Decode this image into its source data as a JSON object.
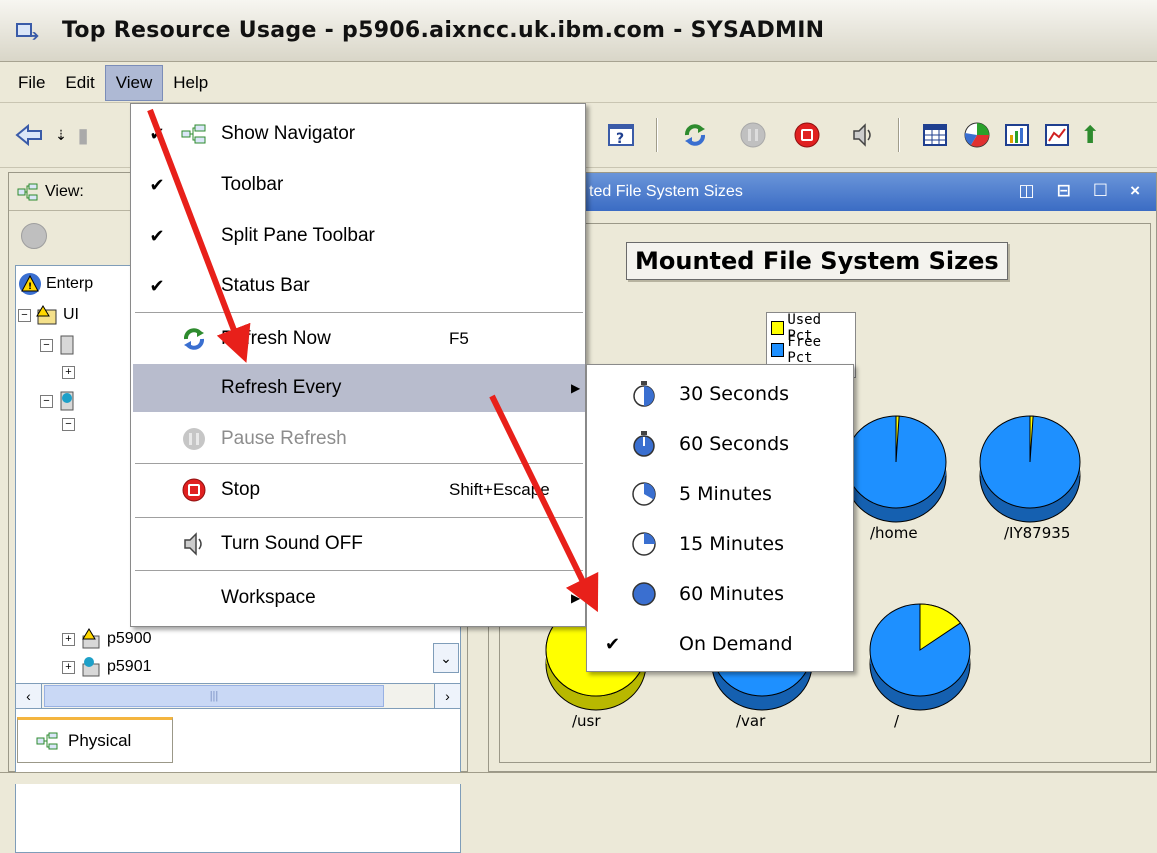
{
  "window": {
    "title": "Top Resource Usage - p5906.aixncc.uk.ibm.com - SYSADMIN"
  },
  "menubar": [
    "File",
    "Edit",
    "View",
    "Help"
  ],
  "left_panel": {
    "view_label": "View:",
    "tree": [
      {
        "label": "Enterp"
      },
      {
        "label": "UI"
      },
      {
        "label": "p5900"
      },
      {
        "label": "p5901"
      }
    ],
    "tab_label": "Physical"
  },
  "workspace": {
    "title": "ted File System Sizes",
    "chart_data": {
      "type": "pie",
      "title": "Mounted File System Sizes",
      "legend": [
        "Used Pct",
        "Free Pct"
      ],
      "colors": {
        "Used Pct": "#ffff00",
        "Free Pct": "#1e90ff"
      },
      "categories": [
        "/home",
        "/IY87935",
        "/usr",
        "/var",
        "/"
      ],
      "series": [
        {
          "name": "Used Pct",
          "values": [
            1,
            1,
            95,
            10,
            15
          ]
        },
        {
          "name": "Free Pct",
          "values": [
            99,
            99,
            5,
            90,
            85
          ]
        }
      ]
    }
  },
  "view_menu": {
    "items": [
      {
        "label": "Show Navigator",
        "checked": true,
        "icon": "navigator-icon"
      },
      {
        "label": "Toolbar",
        "checked": true
      },
      {
        "label": "Split Pane Toolbar",
        "checked": true
      },
      {
        "label": "Status Bar",
        "checked": true
      },
      {
        "label": "Refresh Now",
        "accelerator": "F5",
        "icon": "refresh-icon"
      },
      {
        "label": "Refresh Every",
        "submenu": true
      },
      {
        "label": "Pause Refresh",
        "disabled": true,
        "icon": "pause-icon"
      },
      {
        "label": "Stop",
        "accelerator": "Shift+Escape",
        "icon": "stop-icon"
      },
      {
        "label": "Turn Sound OFF",
        "icon": "speaker-icon"
      },
      {
        "label": "Workspace",
        "submenu": true
      }
    ]
  },
  "refresh_submenu": {
    "items": [
      {
        "label": "30 Seconds",
        "icon": "stopwatch-icon"
      },
      {
        "label": "60 Seconds",
        "icon": "stopwatch-icon"
      },
      {
        "label": "5  Minutes",
        "icon": "clock-5-icon"
      },
      {
        "label": "15 Minutes",
        "icon": "clock-15-icon"
      },
      {
        "label": "60 Minutes",
        "icon": "clock-60-icon"
      },
      {
        "label": "On Demand",
        "checked": true
      }
    ]
  },
  "colors": {
    "menu_highlight": "#b8bccd",
    "workspace_title": "#3b6cc4",
    "annotation_arrow": "#e8201a"
  }
}
